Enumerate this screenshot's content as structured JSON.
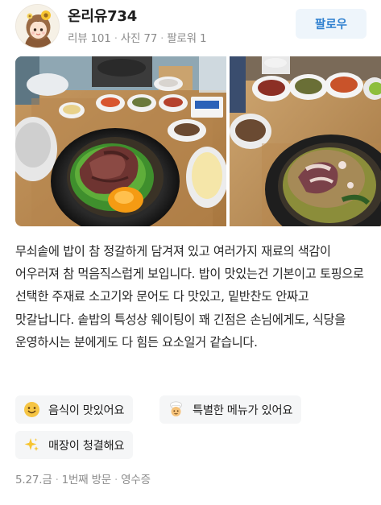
{
  "profile": {
    "name": "온리유734",
    "reviews_label": "리뷰 101",
    "photos_label": "사진 77",
    "followers_label": "팔로워 1",
    "follow_button": "팔로우"
  },
  "photos": [
    {
      "icon": "food-photo-stone-pot-bibimbap"
    },
    {
      "icon": "food-photo-octopus-bibimbap"
    }
  ],
  "review": {
    "text": "무쇠솥에 밥이 참 정갈하게 담겨져 있고 여러가지 재료의 색감이 어우러져 참 먹음직스럽게 보입니다. 밥이 맛있는건 기본이고 토핑으로 선택한 주재료 소고기와 문어도 다 맛있고, 밑반찬도 안짜고 맛갈납니다. 솥밥의 특성상 웨이팅이 꽤 긴점은 손님에게도, 식당을 운영하시는 분에게도 다 힘든 요소일거 같습니다."
  },
  "tags": [
    {
      "label": "음식이 맛있어요",
      "icon": "smile-emoji-icon"
    },
    {
      "label": "특별한 메뉴가 있어요",
      "icon": "chef-emoji-icon"
    },
    {
      "label": "매장이 청결해요",
      "icon": "sparkles-icon"
    }
  ],
  "meta": {
    "date": "5.27.금",
    "visit": "1번째 방문",
    "verification": "영수증"
  },
  "colors": {
    "accent": "#2d7fcf",
    "follow_bg": "#eef5fb",
    "tag_bg": "#f5f6f7",
    "muted_text": "#8c8c8c"
  }
}
